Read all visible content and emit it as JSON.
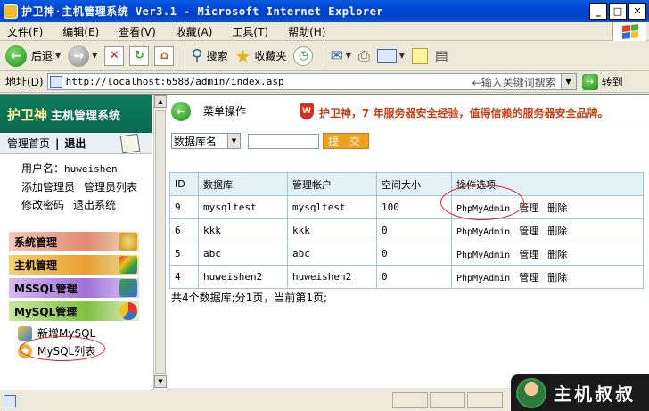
{
  "window": {
    "title": "护卫神·主机管理系统 Ver3.1 - Microsoft Internet Explorer"
  },
  "menu": [
    "文件(F)",
    "编辑(E)",
    "查看(V)",
    "收藏(A)",
    "工具(T)",
    "帮助(H)"
  ],
  "toolbar": {
    "back": "后退",
    "search": "搜索",
    "favorites": "收藏夹"
  },
  "address": {
    "label": "地址(D)",
    "url": "http://localhost:6588/admin/index.asp",
    "search_hint": "←输入关键词搜索",
    "go": "转到"
  },
  "sidebar": {
    "brand_a": "护卫神",
    "brand_b": "主机管理系统",
    "nav_home": "管理首页",
    "nav_sep": "|",
    "nav_logout": "退出",
    "user_label": "用户名：",
    "user_name": "huweishen",
    "links": [
      "添加管理员",
      "管理员列表",
      "修改密码",
      "退出系统"
    ],
    "categories": [
      "系统管理",
      "主机管理",
      "MSSQL管理",
      "MySQL管理"
    ],
    "sub_items": [
      "新增MySQL",
      "MySQL列表"
    ]
  },
  "main": {
    "header": "菜单操作",
    "shield_glyph": "W",
    "slogan": "护卫神，7 年服务器安全经验，值得信赖的服务器安全品牌。",
    "search": {
      "select_value": "数据库名",
      "submit_label": "提 交"
    },
    "table": {
      "headers": [
        "ID",
        "数据库",
        "管理帐户",
        "空间大小",
        "操作选项"
      ],
      "rows": [
        {
          "id": "9",
          "db": "mysqltest",
          "account": "mysqltest",
          "size": "100"
        },
        {
          "id": "6",
          "db": "kkk",
          "account": "kkk",
          "size": "0"
        },
        {
          "id": "5",
          "db": "abc",
          "account": "abc",
          "size": "0"
        },
        {
          "id": "4",
          "db": "huweishen2",
          "account": "huweishen2",
          "size": "0"
        }
      ],
      "op_pma": "PhpMyAdmin",
      "op_manage": "管理",
      "op_delete": "删除"
    },
    "summary": "共4个数据库;分1页，当前第1页;"
  },
  "watermark": {
    "text": "主机叔叔"
  },
  "colors": {
    "accent": "#0c7a5a",
    "slogan": "#c83c12",
    "annotation": "#d62020",
    "button": "#f0a020"
  }
}
